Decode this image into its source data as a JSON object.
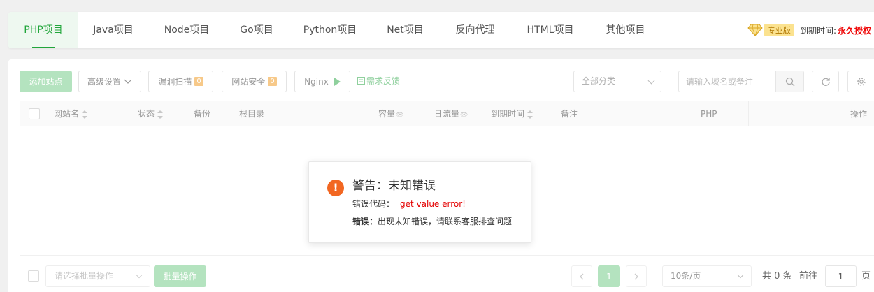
{
  "tabs": [
    {
      "label": "PHP项目",
      "active": true
    },
    {
      "label": "Java项目"
    },
    {
      "label": "Node项目"
    },
    {
      "label": "Go项目"
    },
    {
      "label": "Python项目"
    },
    {
      "label": "Net项目"
    },
    {
      "label": "反向代理"
    },
    {
      "label": "HTML项目"
    },
    {
      "label": "其他项目"
    }
  ],
  "license": {
    "icon": "diamond-icon",
    "badge": "专业版",
    "expire_label": "到期时间:",
    "expire_value": "永久授权"
  },
  "toolbar": {
    "add_site": "添加站点",
    "advanced": "高级设置",
    "vuln_scan": "漏洞扫描",
    "vuln_count": "0",
    "site_security": "网站安全",
    "security_count": "0",
    "nginx": "Nginx",
    "feedback": "需求反馈",
    "category": "全部分类",
    "search_placeholder": "请输入域名或备注"
  },
  "table": {
    "columns": [
      "网站名",
      "状态",
      "备份",
      "根目录",
      "容量",
      "日流量",
      "到期时间",
      "备注",
      "PHP",
      "操作"
    ]
  },
  "dialog": {
    "title": "警告：未知错误",
    "code_label": "错误代码：",
    "code_value": "get value error!",
    "msg_label": "错误：",
    "msg_value": "出现未知错误，请联系客服排查问题"
  },
  "footer": {
    "batch_placeholder": "请选择批量操作",
    "batch_button": "批量操作",
    "current_page": "1",
    "page_size": "10条/页",
    "total_text": "共 0 条",
    "goto_label": "前往",
    "goto_value": "1",
    "page_suffix": "页"
  },
  "colors": {
    "accent": "#20a53a",
    "accent_light": "#b4e3bf",
    "warning": "#f26722",
    "error": "#e30000"
  }
}
